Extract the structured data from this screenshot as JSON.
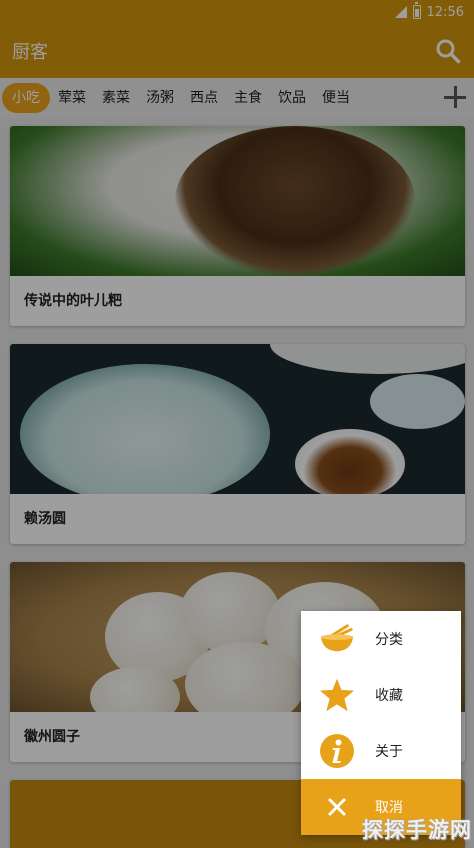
{
  "status_bar": {
    "time": "12:56"
  },
  "app_bar": {
    "title": "厨客",
    "search_icon": "search-icon"
  },
  "tabs": [
    {
      "label": "小吃",
      "active": true
    },
    {
      "label": "荤菜",
      "active": false
    },
    {
      "label": "素菜",
      "active": false
    },
    {
      "label": "汤粥",
      "active": false
    },
    {
      "label": "西点",
      "active": false
    },
    {
      "label": "主食",
      "active": false
    },
    {
      "label": "饮品",
      "active": false
    },
    {
      "label": "便当",
      "active": false
    }
  ],
  "add_icon": "plus-icon",
  "recipes": [
    {
      "name": "传说中的叶儿粑"
    },
    {
      "name": "赖汤圆"
    },
    {
      "name": "徽州圆子"
    }
  ],
  "menu": {
    "items": [
      {
        "label": "分类",
        "icon": "bowl-icon"
      },
      {
        "label": "收藏",
        "icon": "star-icon"
      },
      {
        "label": "关于",
        "icon": "info-icon"
      },
      {
        "label": "取消",
        "icon": "close-icon"
      }
    ]
  },
  "watermark": "探探手游网",
  "colors": {
    "primary": "#d4950c",
    "accent": "#e8a21a",
    "overlay": "rgba(0,0,0,0.38)"
  }
}
